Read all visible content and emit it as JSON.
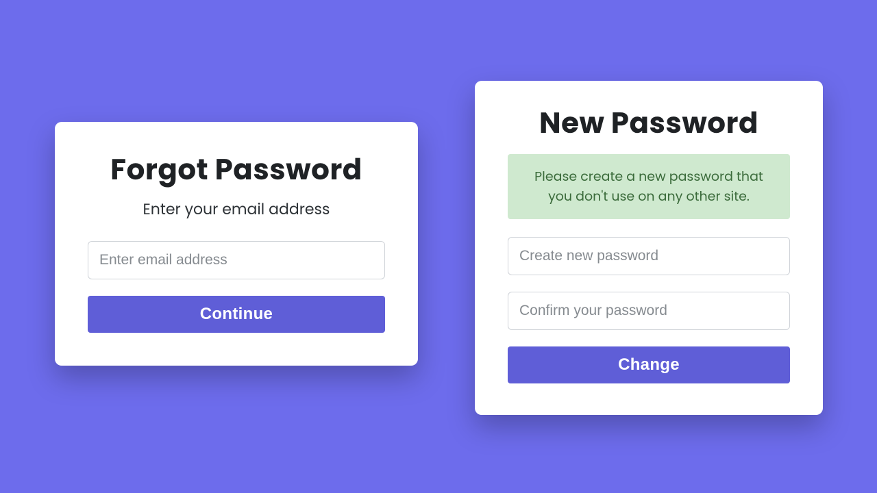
{
  "colors": {
    "background": "#6d6cec",
    "card": "#ffffff",
    "button": "#5f5ed7",
    "button_text": "#ffffff",
    "alert_bg": "#cfe9cf",
    "alert_text": "#3b6b3b",
    "placeholder": "#868b90",
    "heading": "#1f2225"
  },
  "forgot": {
    "title": "Forgot Password",
    "subtitle": "Enter your email address",
    "email_placeholder": "Enter email address",
    "email_value": "",
    "continue_label": "Continue"
  },
  "newpass": {
    "title": "New Password",
    "alert_text": "Please create a new password that you don't use on any other site.",
    "create_placeholder": "Create new password",
    "create_value": "",
    "confirm_placeholder": "Confirm your password",
    "confirm_value": "",
    "change_label": "Change"
  }
}
